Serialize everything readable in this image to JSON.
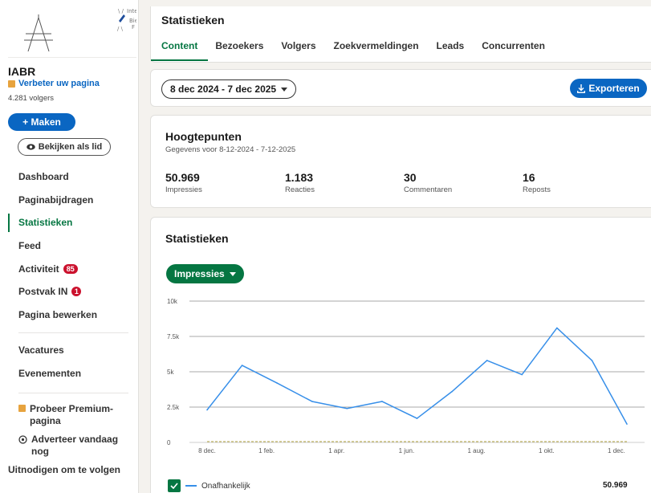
{
  "sidebar": {
    "logo_text_1": "Inte",
    "logo_text_2": "Bie",
    "logo_text_3": "F",
    "org_name": "IABR",
    "improve_label": "Verbeter uw pagina",
    "followers": "4.281 volgers",
    "make_label": "+ Maken",
    "view_label": "Bekijken als lid",
    "nav": [
      {
        "label": "Dashboard"
      },
      {
        "label": "Paginabijdragen"
      },
      {
        "label": "Statistieken",
        "active": true
      },
      {
        "label": "Feed"
      },
      {
        "label": "Activiteit",
        "badge": "85"
      },
      {
        "label": "Postvak IN",
        "badge": "1"
      },
      {
        "label": "Pagina bewerken"
      }
    ],
    "nav2": [
      {
        "label": "Vacatures"
      },
      {
        "label": "Evenementen"
      }
    ],
    "nav3": [
      {
        "label": "Probeer Premium-pagina",
        "icon": "premium-icon"
      },
      {
        "label": "Adverteer vandaag nog",
        "icon": "ad-icon"
      },
      {
        "label": "Uitnodigen om te volgen"
      }
    ]
  },
  "header": {
    "title": "Statistieken",
    "tabs": [
      "Content",
      "Bezoekers",
      "Volgers",
      "Zoekvermeldingen",
      "Leads",
      "Concurrenten"
    ]
  },
  "toolbar": {
    "date_range": "8 dec 2024 - 7 dec 2025",
    "export_label": "Exporteren"
  },
  "highlights": {
    "title": "Hoogtepunten",
    "subtitle": "Gegevens voor 8-12-2024 - 7-12-2025",
    "metrics": [
      {
        "value": "50.969",
        "label": "Impressies"
      },
      {
        "value": "1.183",
        "label": "Reacties"
      },
      {
        "value": "30",
        "label": "Commentaren"
      },
      {
        "value": "16",
        "label": "Reposts"
      }
    ]
  },
  "stats": {
    "title": "Statistieken",
    "metric_selector": "Impressies",
    "legend_label": "Onafhankelijk",
    "legend_total": "50.969"
  },
  "colors": {
    "accent_green": "#057642",
    "accent_blue": "#0a66c2",
    "series_blue": "#378fe9",
    "baseline_olive": "#b5a642"
  },
  "chart_data": {
    "type": "line",
    "title": "",
    "xlabel": "",
    "ylabel": "",
    "ylim": [
      0,
      10000
    ],
    "y_ticks": [
      0,
      2500,
      5000,
      7500,
      10000
    ],
    "y_tick_labels": [
      "0",
      "2.5k",
      "5k",
      "7.5k",
      "10k"
    ],
    "x_tick_labels": [
      "8 dec.",
      "1 feb.",
      "1 apr.",
      "1 jun.",
      "1 aug.",
      "1 okt.",
      "1 dec."
    ],
    "x_tick_index": [
      0,
      1.7,
      3.7,
      5.7,
      7.7,
      9.7,
      11.7
    ],
    "grid": true,
    "legend": "bottom-left",
    "series": [
      {
        "name": "Onafhankelijk",
        "color": "#378fe9",
        "x": [
          0,
          1,
          2,
          3,
          4,
          5,
          6,
          7,
          8,
          9,
          10,
          11,
          12
        ],
        "values": [
          2300,
          5450,
          4200,
          2900,
          2400,
          2900,
          1700,
          3600,
          5800,
          4800,
          8100,
          5800,
          1300
        ]
      },
      {
        "color": "#b5a642",
        "x": [
          0,
          12
        ],
        "values": [
          0,
          0
        ]
      }
    ]
  }
}
